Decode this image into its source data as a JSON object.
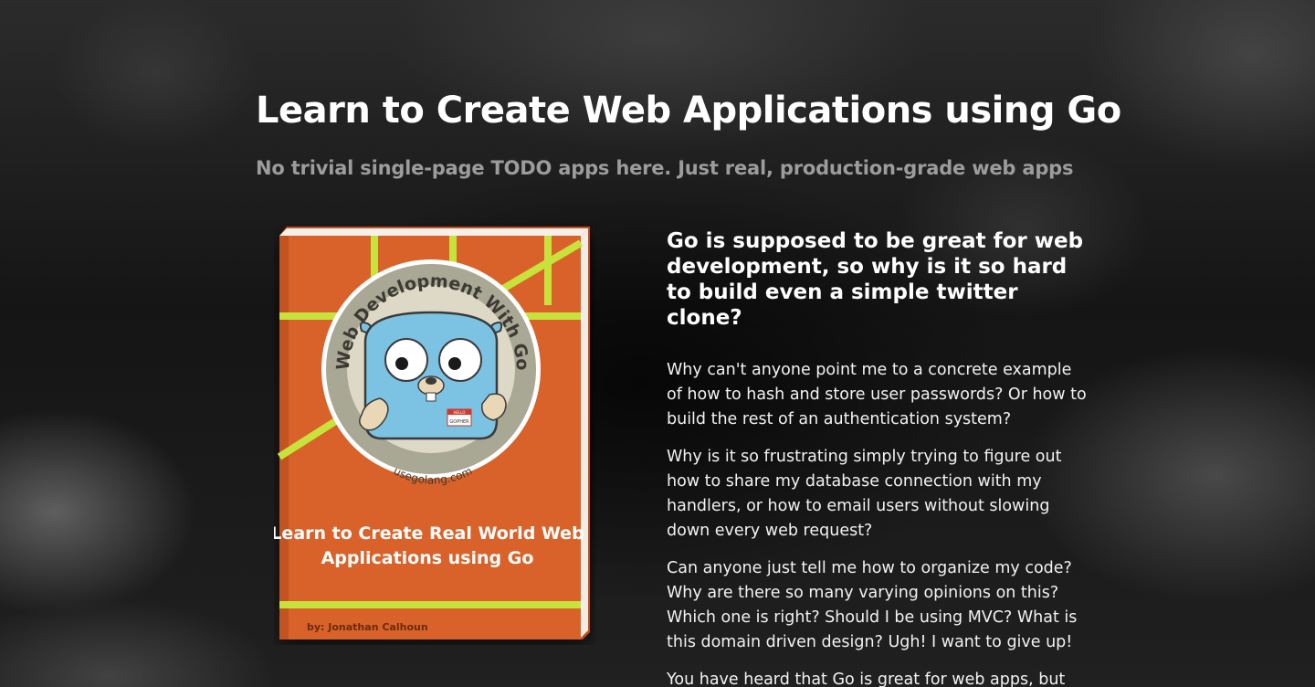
{
  "hero": {
    "title": "Learn to Create Web Applications using Go",
    "subtitle": "No trivial single-page TODO apps here. Just real, production-grade web apps"
  },
  "book": {
    "badge_text": "Web Development With Go",
    "badge_site": "usegolang.com",
    "name_tag_top": "HELLO",
    "name_tag_name": "GOPHER",
    "cover_title_line1": "Learn to Create Real World Web",
    "cover_title_line2": "Applications using Go",
    "author": "by: Jonathan Calhoun",
    "colors": {
      "cover": "#d9622b",
      "stripe": "#c8e23c",
      "gopher": "#7cc3e3",
      "badge_ring": "#a9a894"
    }
  },
  "pitch": {
    "heading": "Go is supposed to be great for web development, so why is it so hard to build even a simple twitter clone?",
    "paragraphs": [
      "Why can't anyone point me to a concrete example of how to hash and store user passwords? Or how to build the rest of an authentication system?",
      "Why is it so frustrating simply trying to figure out how to share my database connection with my handlers, or how to email users without slowing down every web request?",
      "Can anyone just tell me how to organize my code? Why are there so many varying opinions on this? Which one is right? Should I be using MVC? What is this domain driven design? Ugh! I want to give up!",
      "You have heard that Go is great for web apps, but"
    ]
  }
}
